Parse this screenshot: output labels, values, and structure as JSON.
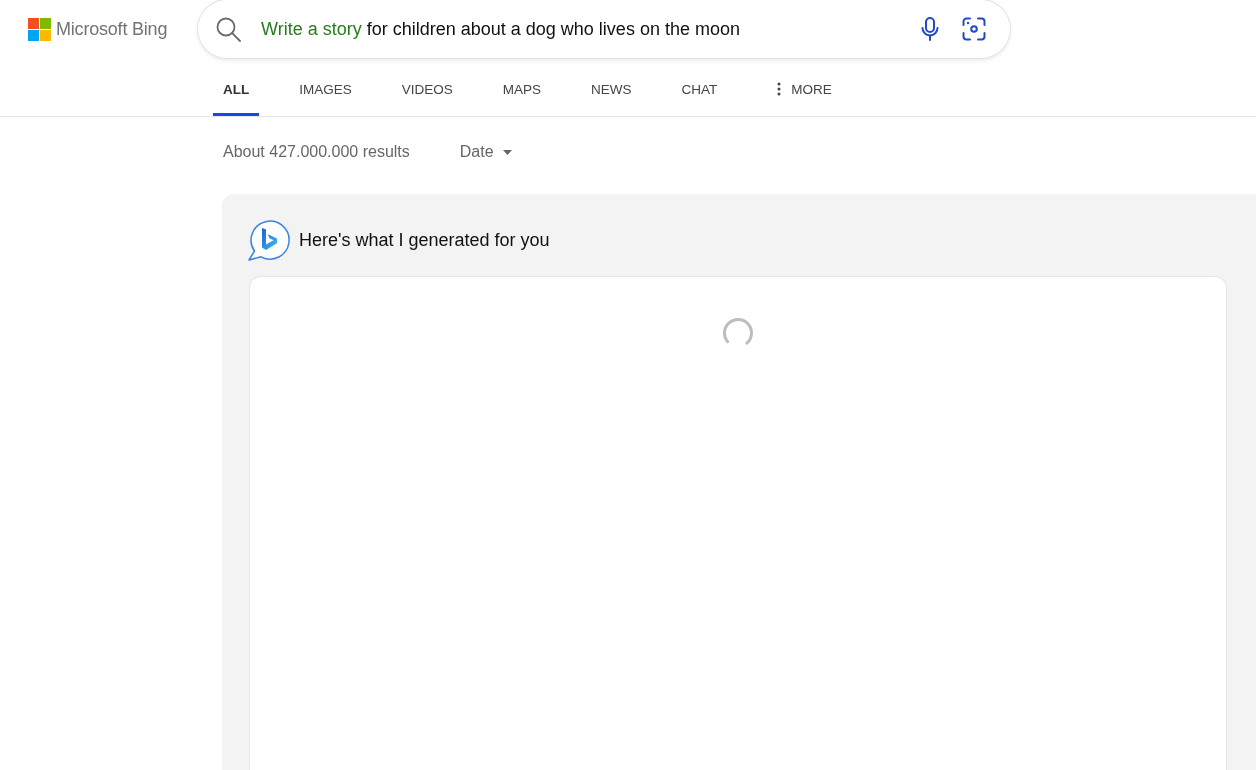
{
  "logo": {
    "text": "Microsoft Bing"
  },
  "search": {
    "query_highlight": "Write a story",
    "query": "for children about a dog who lives on the moon"
  },
  "tabs": [
    {
      "label": "ALL",
      "selected": true,
      "kind": "link"
    },
    {
      "label": "IMAGES",
      "selected": false,
      "kind": "link"
    },
    {
      "label": "VIDEOS",
      "selected": false,
      "kind": "link"
    },
    {
      "label": "MAPS",
      "selected": false,
      "kind": "link"
    },
    {
      "label": "NEWS",
      "selected": false,
      "kind": "link"
    },
    {
      "label": "CHAT",
      "selected": false,
      "kind": "link"
    },
    {
      "label": "MORE",
      "selected": false,
      "kind": "menu"
    }
  ],
  "results": {
    "count": "About 427.000.000 results",
    "filter": "Date"
  },
  "answer": {
    "heading": "Here's what I generated for you",
    "loading": true
  }
}
